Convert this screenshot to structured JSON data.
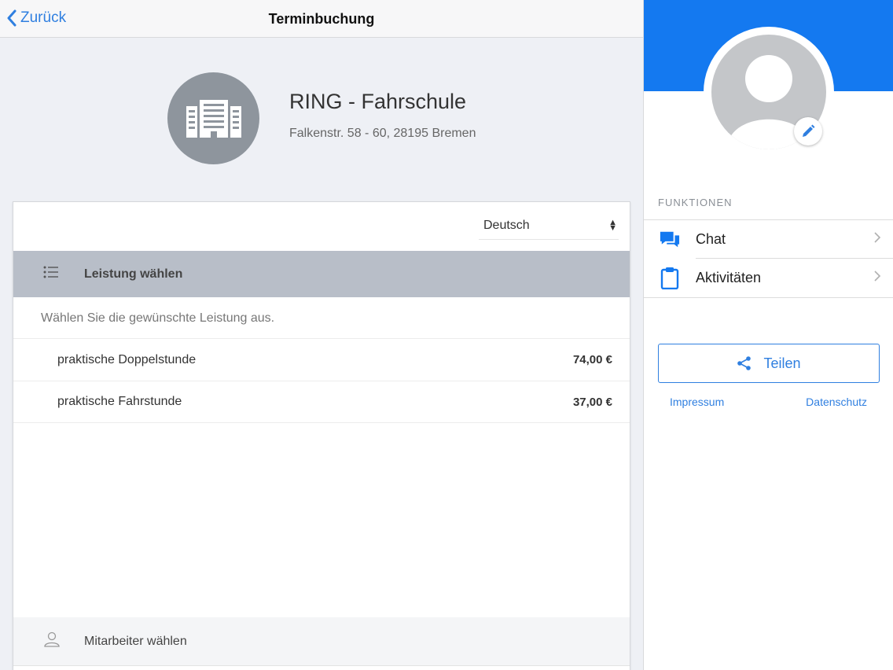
{
  "nav": {
    "back_label": "Zurück",
    "title": "Terminbuchung"
  },
  "business": {
    "name": "RING - Fahrschule",
    "address": "Falkenstr. 58 - 60, 28195 Bremen"
  },
  "booking": {
    "language": "Deutsch",
    "section_service": "Leistung wählen",
    "hint": "Wählen Sie die gewünschte Leistung aus.",
    "services": [
      {
        "name": "praktische Doppelstunde",
        "price": "74,00 €"
      },
      {
        "name": "praktische Fahrstunde",
        "price": "37,00 €"
      }
    ],
    "section_staff": "Mitarbeiter wählen"
  },
  "sidebar": {
    "functions_label": "FUNKTIONEN",
    "items": [
      {
        "label": "Chat",
        "icon": "chat-icon"
      },
      {
        "label": "Aktivitäten",
        "icon": "clipboard-icon"
      }
    ],
    "share_label": "Teilen",
    "links": [
      "Impressum",
      "Datenschutz"
    ]
  },
  "colors": {
    "accent": "#1479f0",
    "link": "#2f7fe0",
    "section_header": "#b8bec8"
  }
}
